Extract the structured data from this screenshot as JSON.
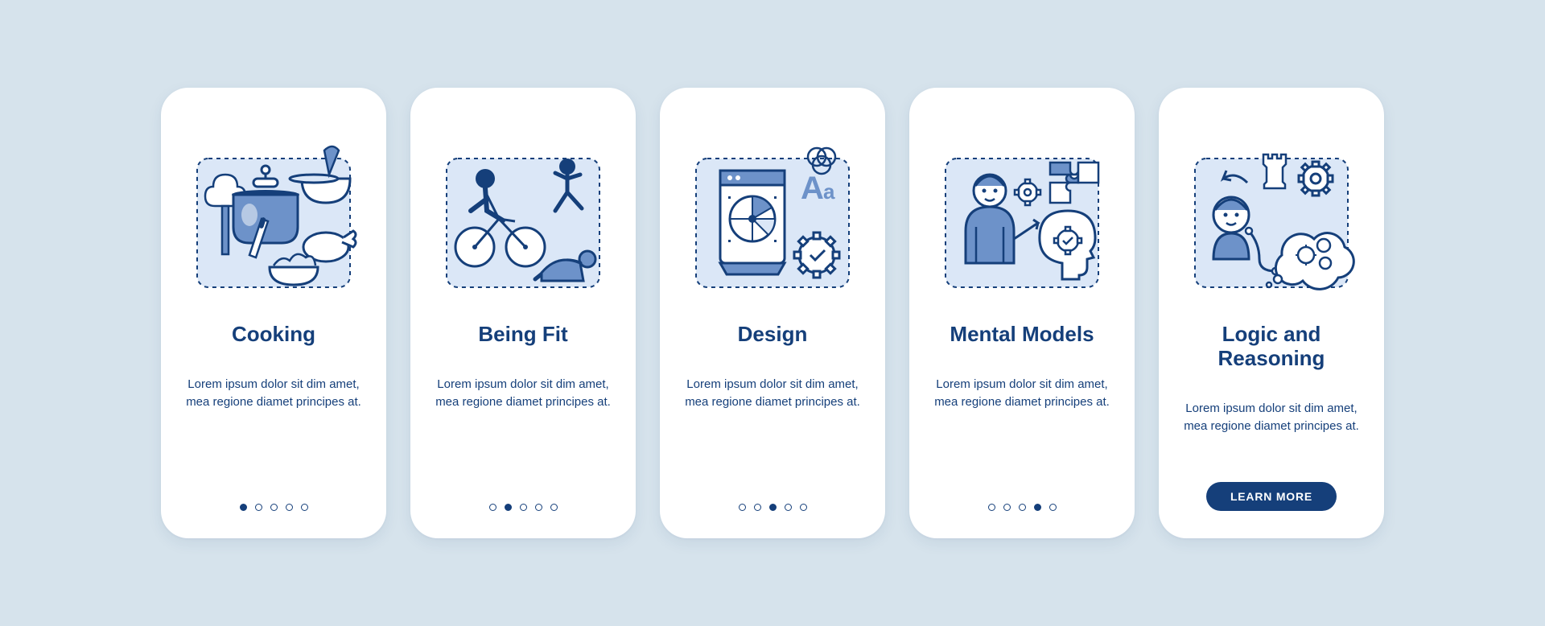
{
  "cards": [
    {
      "title": "Cooking",
      "desc": "Lorem ipsum dolor sit dim amet, mea regione diamet principes at.",
      "activeDot": 0,
      "dotCount": 5,
      "cta": null
    },
    {
      "title": "Being Fit",
      "desc": "Lorem ipsum dolor sit dim amet, mea regione diamet principes at.",
      "activeDot": 1,
      "dotCount": 5,
      "cta": null
    },
    {
      "title": "Design",
      "desc": "Lorem ipsum dolor sit dim amet, mea regione diamet principes at.",
      "activeDot": 2,
      "dotCount": 5,
      "cta": null
    },
    {
      "title": "Mental Models",
      "desc": "Lorem ipsum dolor sit dim amet, mea regione diamet principes at.",
      "activeDot": 3,
      "dotCount": 5,
      "cta": null
    },
    {
      "title": "Logic and Reasoning",
      "desc": "Lorem ipsum dolor sit dim amet, mea regione diamet principes at.",
      "activeDot": null,
      "dotCount": 0,
      "cta": "LEARN MORE"
    }
  ],
  "colors": {
    "primary": "#153f7a",
    "lightFill": "#dbe7f7",
    "midFill": "#6d92c9",
    "bg": "#d6e3ec"
  }
}
